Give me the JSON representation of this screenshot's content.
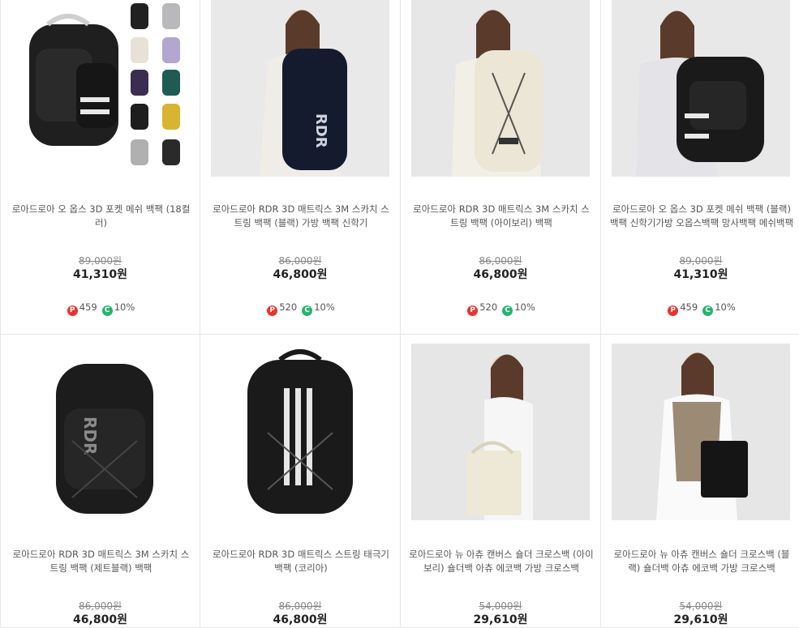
{
  "products": [
    {
      "title": "로아드로아 오 옵스 3D 포켓 메쉬 백팩 (18컬러)",
      "original_price": "89,000원",
      "price": "41,310원",
      "point": "459",
      "coupon": "10%",
      "point_badge": "P",
      "coupon_badge": "C",
      "image": "black-backpack-with-color-swatches"
    },
    {
      "title": "로아드로아 RDR 3D 매트릭스 3M 스카치 스트링 백팩 (블랙) 가방 백팩 신학기",
      "original_price": "86,000원",
      "price": "46,800원",
      "point": "520",
      "coupon": "10%",
      "point_badge": "P",
      "coupon_badge": "C",
      "image": "model-wearing-navy-backpack"
    },
    {
      "title": "로아드로아 RDR 3D 매트릭스 3M 스카치 스트링 백팩 (아이보리) 백팩",
      "original_price": "86,000원",
      "price": "46,800원",
      "point": "520",
      "coupon": "10%",
      "point_badge": "P",
      "coupon_badge": "C",
      "image": "model-wearing-ivory-backpack"
    },
    {
      "title": "로아드로아 오 옵스 3D 포켓 메쉬 백팩 (블랙) 백팩 신학기가방 오옵스백팩 망사백팩 메쉬백팩",
      "original_price": "89,000원",
      "price": "41,310원",
      "point": "459",
      "coupon": "10%",
      "point_badge": "P",
      "coupon_badge": "C",
      "image": "model-wearing-black-backpack"
    },
    {
      "title": "로아드로아 RDR 3D 매트릭스 3M 스카치 스트링 백팩 (제트블랙) 백팩",
      "original_price": "86,000원",
      "price": "46,800원",
      "image": "jet-black-backpack"
    },
    {
      "title": "로아드로아 RDR 3D 매트릭스 스트링 태극기 백팩 (코리아)",
      "original_price": "86,000원",
      "price": "46,800원",
      "image": "black-backpack-white-stripes"
    },
    {
      "title": "로아드로아 뉴 아츄 캔버스 숄더 크로스백 (아이보리) 숄더백 아츄 에코백 가방 크로스백",
      "original_price": "54,000원",
      "price": "29,610원",
      "image": "model-with-ivory-shoulder-bag"
    },
    {
      "title": "로아드로아 뉴 아츄 캔버스 숄더 크로스백 (블랙) 숄더백 아츄 에코백 가방 크로스백",
      "original_price": "54,000원",
      "price": "29,610원",
      "image": "model-with-black-shoulder-bag"
    }
  ]
}
